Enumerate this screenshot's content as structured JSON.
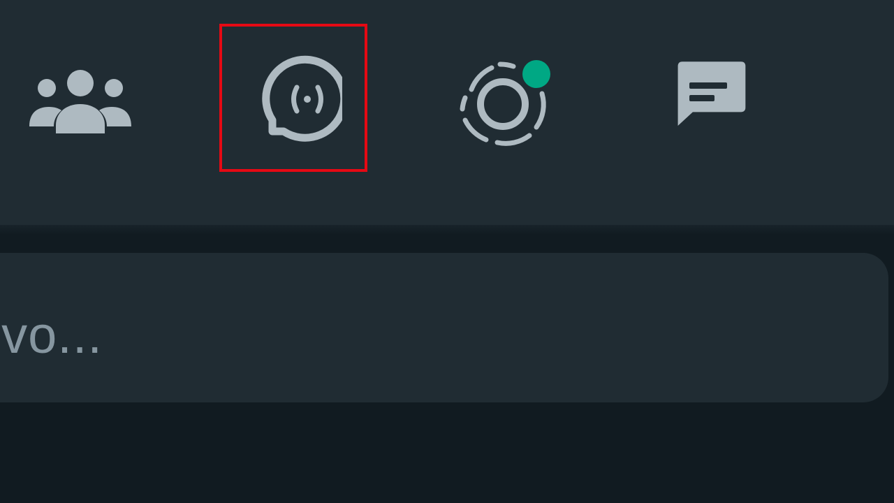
{
  "header": {
    "icons": [
      {
        "name": "communities-icon"
      },
      {
        "name": "channels-icon"
      },
      {
        "name": "status-icon"
      },
      {
        "name": "new-chat-icon"
      }
    ]
  },
  "search": {
    "visible_text": "evo..."
  },
  "colors": {
    "header_bg": "#202c33",
    "page_bg": "#111b21",
    "icon": "#aebac1",
    "status_dot": "#00a884",
    "highlight": "#e50914",
    "placeholder": "#8696a0"
  }
}
